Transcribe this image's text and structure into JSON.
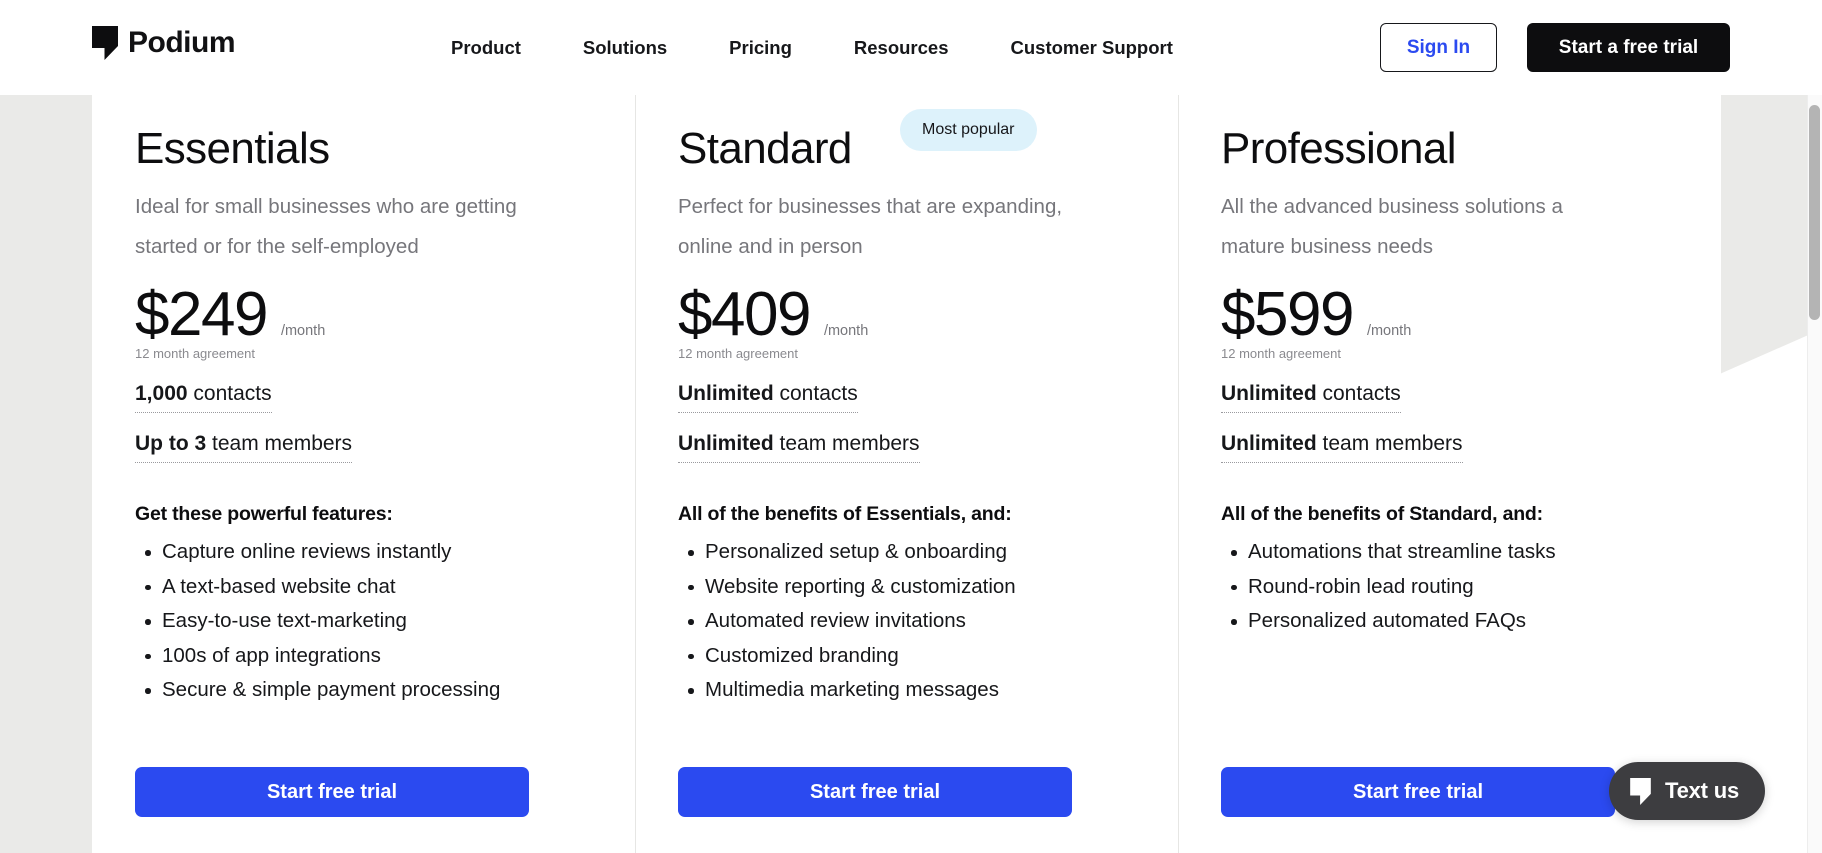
{
  "header": {
    "logo_text": "Podium",
    "logo_icon": "podium-logo-mark",
    "nav": [
      {
        "label": "Product"
      },
      {
        "label": "Solutions"
      },
      {
        "label": "Pricing"
      },
      {
        "label": "Resources"
      },
      {
        "label": "Customer Support"
      }
    ],
    "sign_in_label": "Sign In",
    "trial_label": "Start a free trial",
    "accent_blue": "#2b4af0",
    "dark": "#0d0d0f"
  },
  "badge": {
    "label": "Most popular",
    "bg": "#ddf2fb"
  },
  "plans": [
    {
      "name": "Essentials",
      "description": "Ideal for small businesses who are getting started or for the self-employed",
      "price": "$249",
      "period": "/month",
      "agreement": "12 month agreement",
      "contacts_value": "1,000",
      "contacts_label": " contacts",
      "team_value": "Up to 3",
      "team_label": " team members",
      "features_title": "Get these powerful features:",
      "features": [
        "Capture online reviews instantly",
        "A text-based website chat",
        "Easy-to-use text-marketing",
        "100s of app integrations",
        "Secure & simple payment processing"
      ],
      "cta": "Start free trial"
    },
    {
      "name": "Standard",
      "description": "Perfect for businesses that are expanding, online and in person",
      "price": "$409",
      "period": "/month",
      "agreement": "12 month agreement",
      "contacts_value": "Unlimited",
      "contacts_label": " contacts",
      "team_value": "Unlimited",
      "team_label": " team members",
      "features_title": "All of the benefits of Essentials, and:",
      "features": [
        "Personalized setup & onboarding",
        "Website reporting & customization",
        "Automated review invitations",
        "Customized branding",
        "Multimedia marketing messages"
      ],
      "cta": "Start free trial"
    },
    {
      "name": "Professional",
      "description": "All the advanced business solutions a mature business needs",
      "price": "$599",
      "period": "/month",
      "agreement": "12 month agreement",
      "contacts_value": "Unlimited",
      "contacts_label": " contacts",
      "team_value": "Unlimited",
      "team_label": " team members",
      "features_title": "All of the benefits of Standard, and:",
      "features": [
        "Automations that streamline tasks",
        "Round-robin lead routing",
        "Personalized automated FAQs"
      ],
      "cta": "Start free trial"
    }
  ],
  "chat_widget": {
    "label": "Text us",
    "icon": "podium-logo-mark",
    "bg": "#3d3d40"
  }
}
